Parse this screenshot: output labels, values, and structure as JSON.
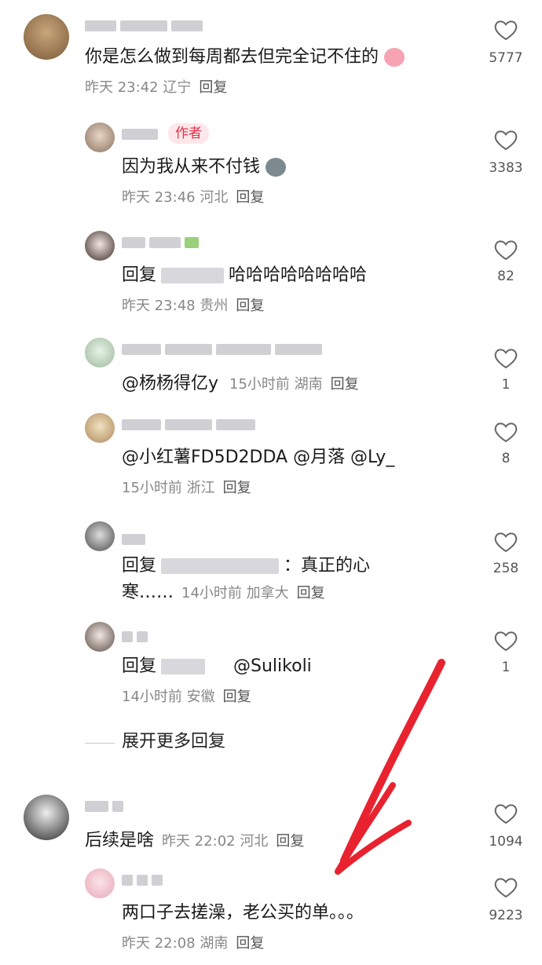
{
  "comments": [
    {
      "text": "你是怎么做到每周都去但完全记不住的",
      "emoji": "blush-face-emoji",
      "time": "昨天 23:42",
      "location": "辽宁",
      "reply": "回复",
      "likes": "5777"
    },
    {
      "author_tag": "作者",
      "text": "因为我从来不付钱",
      "emoji": "cat-emoji",
      "time": "昨天 23:46",
      "location": "河北",
      "reply": "回复",
      "likes": "3383"
    },
    {
      "prefix": "回复",
      "text": "哈哈哈哈哈哈哈哈",
      "time": "昨天 23:48",
      "location": "贵州",
      "reply": "回复",
      "likes": "82"
    },
    {
      "text": "@杨杨得亿y",
      "time": "15小时前",
      "location": "湖南",
      "reply": "回复",
      "likes": "1"
    },
    {
      "text": "@小红薯FD5D2DDA  @月落  @Ly_",
      "time": "15小时前",
      "location": "浙江",
      "reply": "回复",
      "likes": "8"
    },
    {
      "prefix": "回复",
      "text": "：真正的心",
      "text2": "寒……",
      "time": "14小时前",
      "location": "加拿大",
      "reply": "回复",
      "likes": "258"
    },
    {
      "prefix": "回复",
      "text": "@Sulikoli",
      "time": "14小时前",
      "location": "安徽",
      "reply": "回复",
      "likes": "1"
    }
  ],
  "expand_label": "展开更多回复",
  "comments2": [
    {
      "text": "后续是啥",
      "time": "昨天 22:02",
      "location": "河北",
      "reply": "回复",
      "likes": "1094"
    },
    {
      "text": "两口子去搓澡，老公买的单。。。",
      "time": "昨天 22:08",
      "location": "湖南",
      "reply": "回复",
      "likes": "9223"
    }
  ],
  "colors": {
    "accent_arrow": "#e8232f",
    "author_tag_bg": "#fde7ea",
    "author_tag_text": "#e0304a"
  }
}
